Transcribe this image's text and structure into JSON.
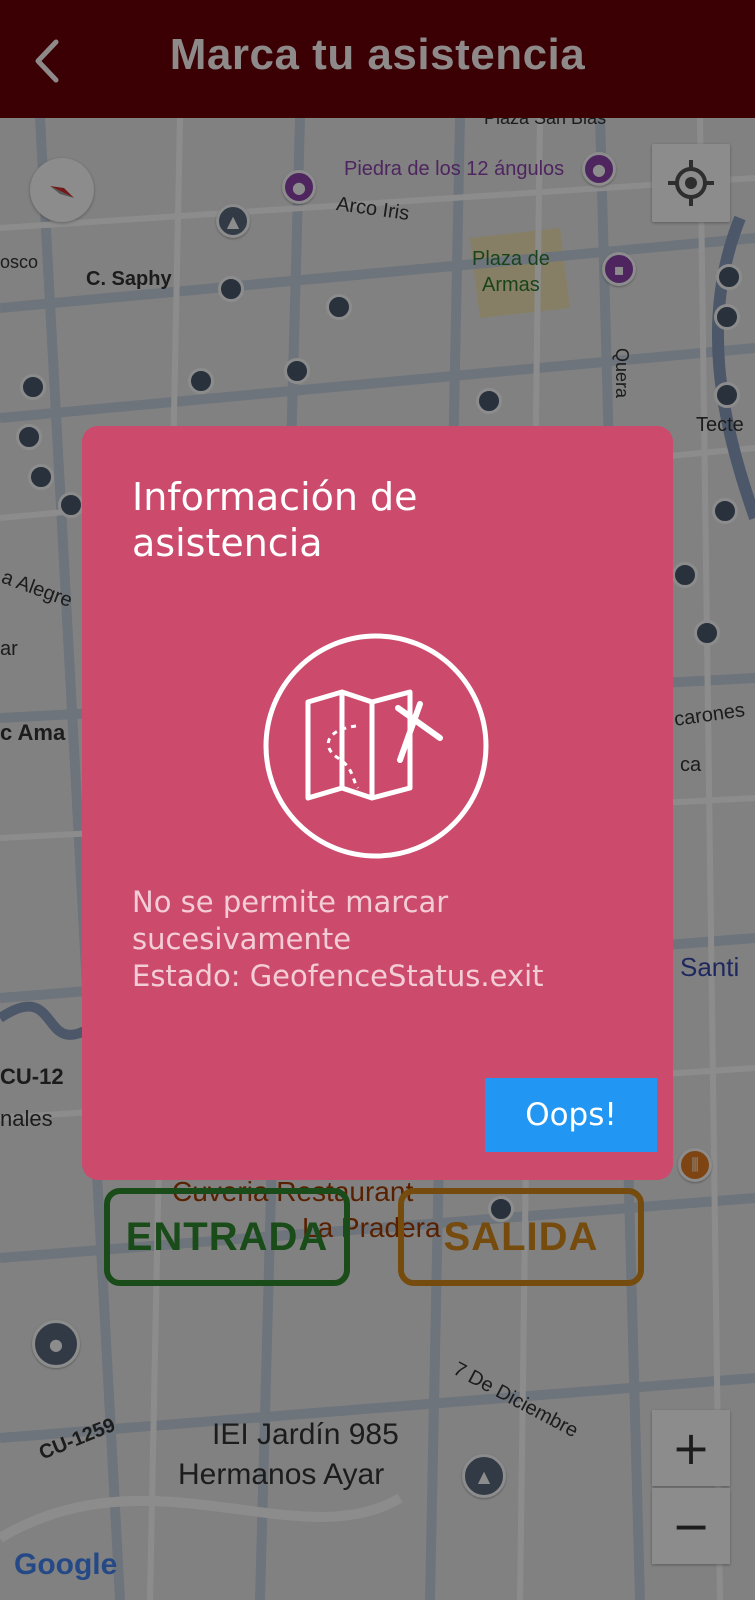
{
  "header": {
    "title": "Marca tu asistencia"
  },
  "map": {
    "labels": [
      "Piedra de los 12 ángulos",
      "Arco Iris",
      "Plaza de",
      "Armas",
      "C. Saphy",
      "osco",
      "Quera",
      "Tecte",
      "a Alegre",
      "ar",
      "c Ama",
      "carones",
      "ca",
      "Santi",
      "CU-12",
      "nales",
      "Cuveria Restaurant",
      "La Pradera",
      "7 De Diciembre",
      "CU-1259",
      "IEI Jardín 985",
      "Hermanos Ayar",
      "Google",
      "Plaza San Blas"
    ],
    "zoom_in": "+",
    "zoom_out": "−"
  },
  "actions": {
    "entrada": "ENTRADA",
    "salida": "SALIDA"
  },
  "dialog": {
    "title": "Información de asistencia",
    "message_line1": "No se permite marcar sucesivamente",
    "message_line2": "Estado: GeofenceStatus.exit",
    "button": "Oops!",
    "icon": "map-off-icon"
  },
  "colors": {
    "header_bg": "#3a0004",
    "dialog_bg": "#cc4a6c",
    "dialog_button": "#2196f3",
    "entrada": "#2e8b2e",
    "salida": "#d68a18"
  }
}
